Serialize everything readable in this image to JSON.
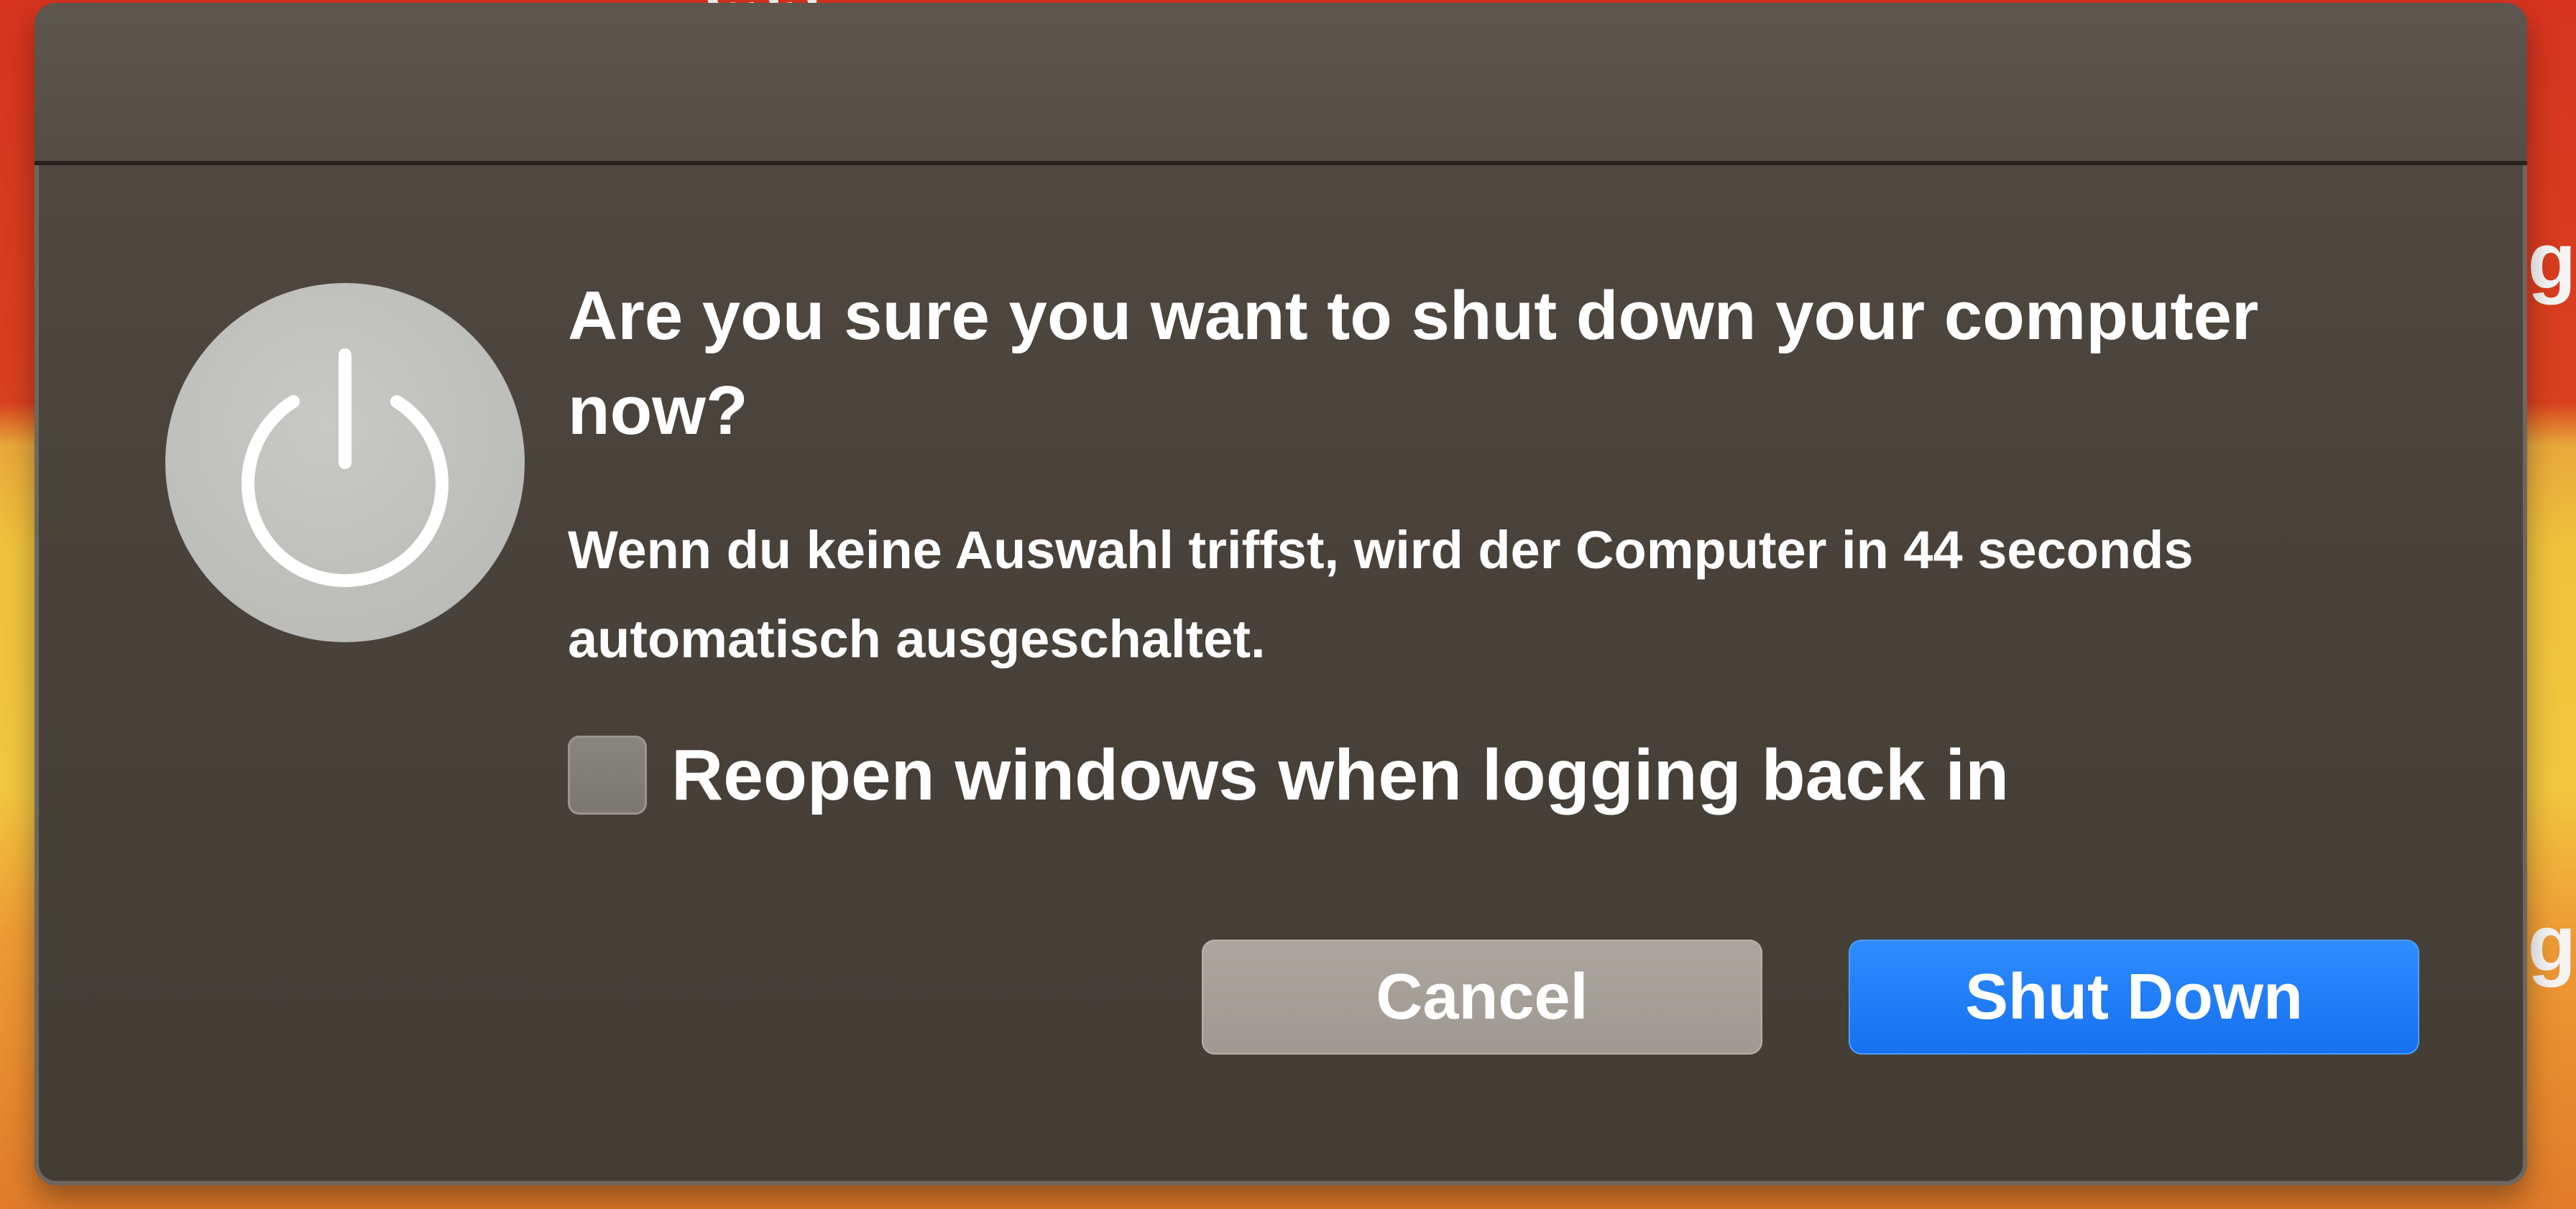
{
  "dialog": {
    "title": "Are you sure you want to shut down your computer now?",
    "message": "Wenn du keine Auswahl triffst, wird der Computer in 44 seconds automatisch ausgeschaltet.",
    "countdown_seconds": 44,
    "icon": "power-icon",
    "checkbox": {
      "label": "Reopen windows when logging back in",
      "checked": false
    },
    "buttons": {
      "cancel_label": "Cancel",
      "shutdown_label": "Shut Down"
    },
    "colors": {
      "dialog_background": "#4a433b",
      "accent": "#1670f0",
      "cancel_button": "#a49e97",
      "icon_circle": "#bcbcb8"
    }
  }
}
